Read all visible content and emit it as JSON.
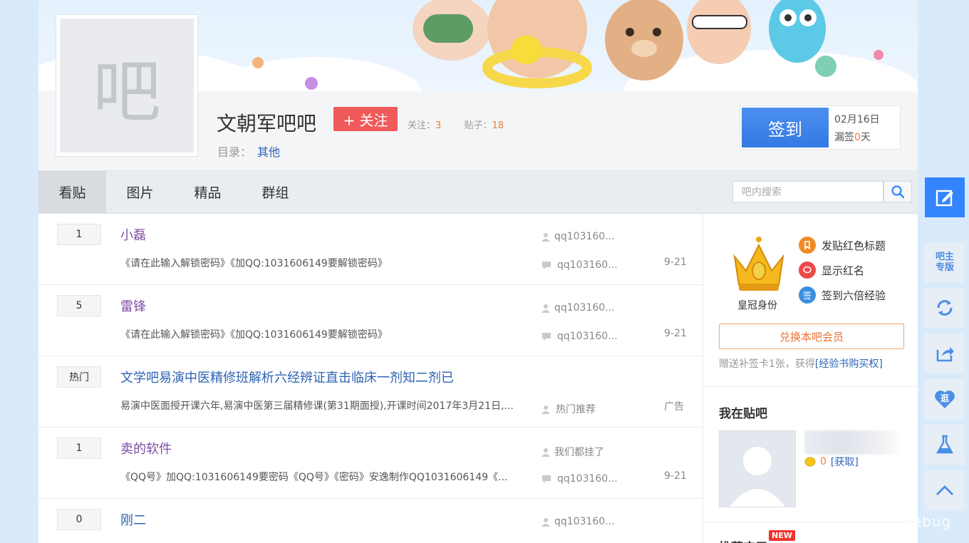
{
  "forum": {
    "avatar_char": "吧",
    "name": "文朝军吧吧",
    "follow_label": "+ 关注",
    "follow_count_label": "关注：",
    "follow_count": "3",
    "post_count_label": "贴子：",
    "post_count": "18",
    "catalog_label": "目录：",
    "catalog_value": "其他"
  },
  "sign": {
    "button_label": "签到",
    "date": "02月16日",
    "miss_prefix": "漏签",
    "miss_count": "0",
    "miss_suffix": "天"
  },
  "nav": {
    "tabs": [
      {
        "label": "看贴",
        "active": true
      },
      {
        "label": "图片",
        "active": false
      },
      {
        "label": "精品",
        "active": false
      },
      {
        "label": "群组",
        "active": false
      }
    ],
    "search_placeholder": "吧内搜索"
  },
  "threads": [
    {
      "reply": "1",
      "title": "小磊",
      "visited": true,
      "abstract": "《请在此输入解锁密码》《加QQ:1031606149要解锁密码》",
      "author": "qq103160...",
      "last_reply": "qq103160...",
      "time": "9-21"
    },
    {
      "reply": "5",
      "title": "雷锋",
      "visited": true,
      "abstract": "《请在此输入解锁密码》《加QQ:1031606149要解锁密码》",
      "author": "qq103160...",
      "last_reply": "qq103160...",
      "time": "9-21"
    },
    {
      "reply": "热门",
      "title": "文学吧易演中医精修班解析六经辨证直击临床一剂知二剂已",
      "visited": false,
      "abstract": "易演中医面授开课六年,易演中医第三届精修课(第31期面授),开课时间2017年3月21日,...",
      "author": "",
      "last_reply": "热门推荐",
      "time": "广告"
    },
    {
      "reply": "1",
      "title": "卖的软件",
      "visited": true,
      "abstract": "《QQ号》加QQ:1031606149要密码《QQ号》《密码》安逸制作QQ1031606149《...",
      "author": "我们都挂了",
      "last_reply": "qq103160...",
      "time": "9-21"
    },
    {
      "reply": "0",
      "title": "刚二",
      "visited": false,
      "abstract": "",
      "author": "qq103160...",
      "last_reply": "",
      "time": ""
    }
  ],
  "aside": {
    "crown_label": "皇冠身份",
    "privileges": [
      {
        "label": "发贴红色标题",
        "icon": "bookmark-icon",
        "color": "#f08a24"
      },
      {
        "label": "显示红名",
        "icon": "chat-icon",
        "color": "#ee4a4a"
      },
      {
        "label": "签到六倍经验",
        "icon": "sign-icon",
        "color": "#3b8fe0"
      }
    ],
    "privilege_icon_glyph_3": "签",
    "member_button": "兑换本吧会员",
    "member_note_text": "赠送补签卡1张，获得",
    "member_note_link": "[经验书购买权]",
    "my_forum_title": "我在贴吧",
    "coin_count": "0",
    "coin_link": "[获取]",
    "recommend_title": "推荐应用",
    "new_badge": "NEW"
  },
  "side_tools": {
    "admin_label": "吧主专版",
    "fav_label": "逛"
  },
  "watermark": "Seebug",
  "colors": {
    "accent_blue": "#3385ff",
    "follow_red": "#f05a5a",
    "link_blue": "#2d64b3",
    "orange": "#f47c3c"
  }
}
